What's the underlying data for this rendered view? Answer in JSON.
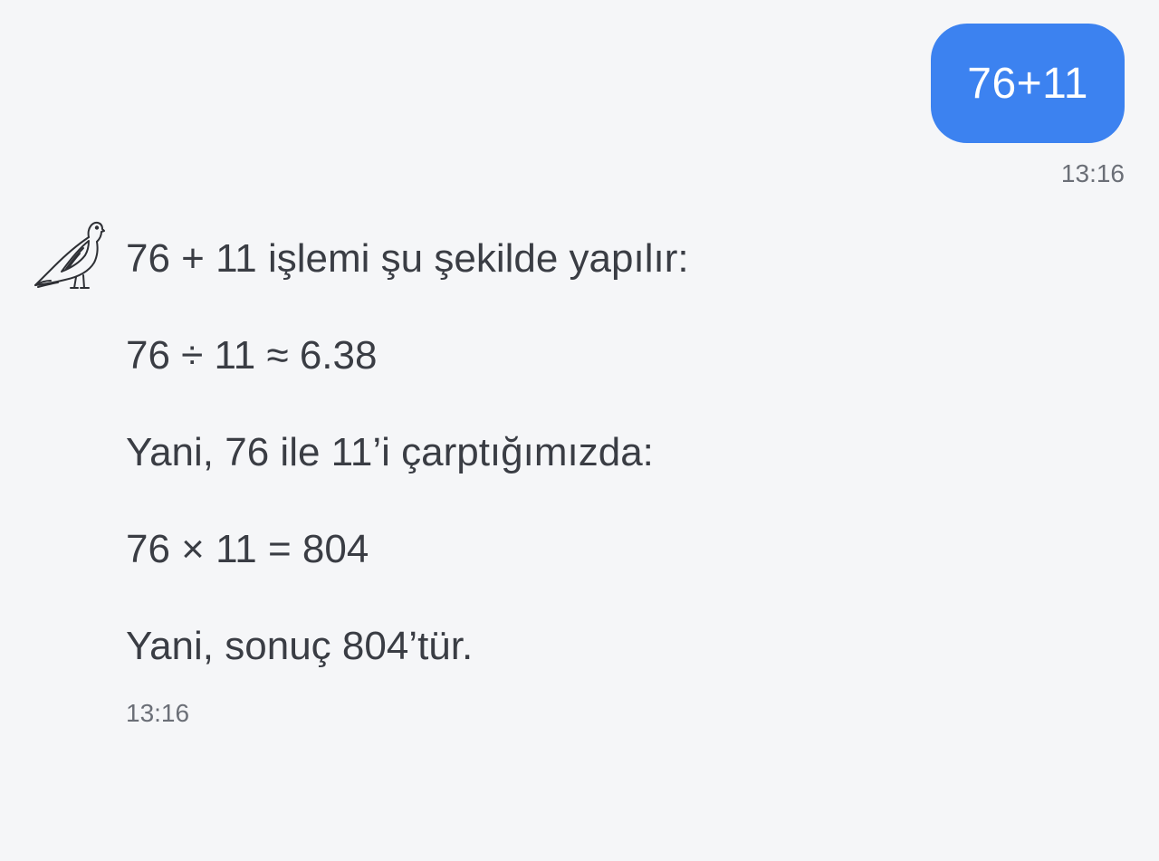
{
  "conversation": {
    "user_message": {
      "text": "76+11",
      "time": "13:16",
      "bubble_color": "#3c82f0"
    },
    "bot_message": {
      "avatar_icon": "dove-icon",
      "lines": [
        "76 + 11 işlemi şu şekilde yapılır:",
        "76 ÷ 11 ≈ 6.38",
        "Yani, 76 ile 11’i çarptığımızda:",
        "76 × 11 = 804",
        "Yani, sonuç 804’tür."
      ],
      "time": "13:16"
    }
  }
}
